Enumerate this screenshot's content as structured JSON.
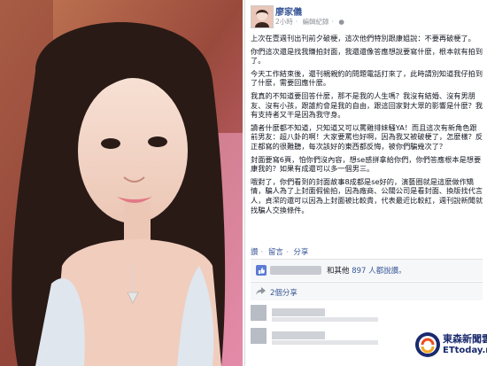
{
  "post": {
    "author": "廖家儀",
    "time": "2小時",
    "edit_history": "編輯紀錄",
    "paragraphs": [
      "上次在壹週刊出刊前夕破梗，這次他們特別跟康姐說：不要再破梗了。",
      "你們這次還是找我賺拍封面，我還還像答應想說要寫什麼，根本就有拍到了。",
      "今天工作結束後，還刊親親約的問題電話打來了，此時請別知道我仔拍到了什麼，需要回應什麼。",
      "我真的不知道要回答什麼，那不是我的人生嗎？我沒有結婚、沒有男朋友、沒有小孩，跟誰約會是我的自由，跟這回家對大眾的影響是什麼？我有支持者又干是因為我守身。",
      "讀者什麼都不知道，只知道又可以罵雞排妹騷YA！而且這次有新角色跟前男友：超八卦的啊！大家要罵也好啊，因為我又被破梗了，怎麼樣？反正都寫的很難聽，每次該好的東西都反悔，被你們騙幾次了？",
      "封面要寫6頁，怕你們沒內容，想se感拼拿給你們，你們答應根本是想要康我的？如果有成還可以多一個男三。",
      "哦對了，你們看到的封面故事8成都是se好的，演藝圈就是這麼做作矯情，騙人為了上封面假偷拍，因為廠商、公關公司是看封面、換版找代言人，貞潔的還可以因為上封面被比較貴，代表最近比較紅，週刊說新聞就找騙人交換條件。"
    ],
    "actions": {
      "like": "讚",
      "comment": "留言",
      "share": "分享"
    },
    "likes_text_mid": "和其他",
    "likes_count": "897",
    "likes_text_end": "人都說讚。",
    "shares": "2個分享"
  },
  "watermark": {
    "top": "東森新聞雲",
    "bottom": "ETtoday.net"
  },
  "colors": {
    "link": "#3b5998",
    "text": "#141823",
    "meta": "#90949c",
    "watermark": "#1a2a6e"
  }
}
